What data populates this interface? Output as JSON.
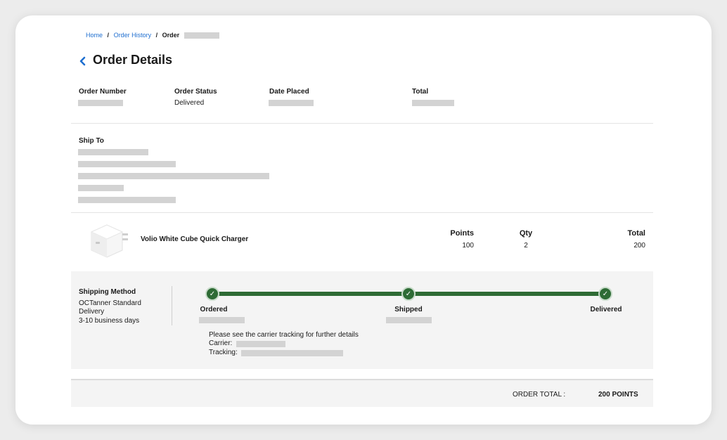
{
  "breadcrumb": {
    "home": "Home",
    "sep1": "/",
    "history": "Order History",
    "sep2": "/",
    "order": "Order"
  },
  "page_title": "Order Details",
  "summary": {
    "order_number_label": "Order Number",
    "order_status_label": "Order Status",
    "order_status_value": "Delivered",
    "date_placed_label": "Date Placed",
    "total_label": "Total"
  },
  "ship_to": {
    "label": "Ship To"
  },
  "item": {
    "name": "Volio White Cube Quick Charger",
    "points_label": "Points",
    "points_value": "100",
    "qty_label": "Qty",
    "qty_value": "2",
    "total_label": "Total",
    "total_value": "200"
  },
  "shipping": {
    "method_label": "Shipping Method",
    "method_line1": "OCTanner Standard",
    "method_line2": "Delivery",
    "method_line3": "3-10 business days",
    "steps": [
      "Ordered",
      "Shipped",
      "Delivered"
    ],
    "check": "✓",
    "note": "Please see the carrier tracking for further details",
    "carrier_label": "Carrier:",
    "tracking_label": "Tracking:"
  },
  "order_total": {
    "label": "ORDER TOTAL :",
    "value": "200 POINTS"
  },
  "colors": {
    "link": "#1f6fd0",
    "progress": "#2e6b35",
    "panel": "#f4f4f4"
  }
}
